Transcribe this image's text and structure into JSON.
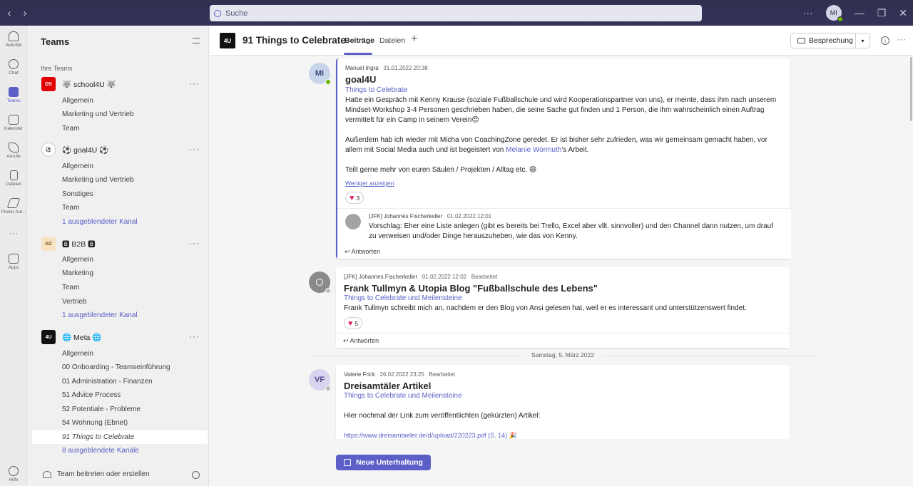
{
  "search": {
    "placeholder": "Suche"
  },
  "topbar": {
    "avatar_initials": "MI",
    "more": "···",
    "min": "—",
    "restore": "❐",
    "close": "✕",
    "back": "‹",
    "forward": "›"
  },
  "rail": [
    {
      "label": "Aktivität",
      "icon": "bell-icon"
    },
    {
      "label": "Chat",
      "icon": "chat-icon"
    },
    {
      "label": "Teams",
      "icon": "teams-icon",
      "active": true
    },
    {
      "label": "Kalender",
      "icon": "calendar-icon"
    },
    {
      "label": "Anrufe",
      "icon": "phone-icon"
    },
    {
      "label": "Dateien",
      "icon": "file-icon"
    },
    {
      "label": "Power Aut...",
      "icon": "power-automate-icon"
    },
    {
      "label": "···",
      "icon": "more-icon"
    },
    {
      "label": "Apps",
      "icon": "apps-icon"
    },
    {
      "label": "Hilfe",
      "icon": "help-icon"
    }
  ],
  "sidebar": {
    "title": "Teams",
    "section": "Ihre Teams",
    "teams": [
      {
        "name": "🐺 school4U 🐺",
        "logo_text": "DS",
        "logo_bg": "#e00000",
        "logo_fg": "#ffffff",
        "channels": [
          "Allgemein",
          "Marketing und Vertrieb",
          "Team"
        ]
      },
      {
        "name": "⚽ goal4U ⚽",
        "logo_text": "⚽",
        "logo_bg": "#ffffff",
        "logo_fg": "#2a7a2a",
        "channels": [
          "Allgemein",
          "Marketing und Vertrieb",
          "Sonstiges",
          "Team"
        ],
        "hidden": "1 ausgeblendeter Kanal"
      },
      {
        "name": "🅱 B2B 🅱",
        "logo_text": "B2",
        "logo_bg": "#f6e3c3",
        "logo_fg": "#8a5a1a",
        "channels": [
          "Allgemein",
          "Marketing",
          "Team",
          "Vertrieb"
        ],
        "hidden": "1 ausgeblendeter Kanal"
      },
      {
        "name": "🌐 Meta 🌐",
        "logo_text": "4U",
        "logo_bg": "#111111",
        "logo_fg": "#ffffff",
        "channels": [
          "Allgemein",
          "00 Onboarding - Teamseinführung",
          "01 Administration - Finanzen",
          "51 Advice Process",
          "52 Potentiale - Probleme",
          "54 Wohnung (Ebnet)",
          "91 Things to Celebrate"
        ],
        "hidden": "8 ausgeblendete Kanäle"
      }
    ],
    "footer": "Team beitreten oder erstellen"
  },
  "header": {
    "logo_text": "4U",
    "title": "91 Things to Celebrate",
    "tabs": [
      "Beiträge",
      "Dateien"
    ],
    "meeting_button": "Besprechung"
  },
  "posts": [
    {
      "author": "Manuel Ingra",
      "time": "31.01.2022 20:38",
      "initials": "MI",
      "subject": "goal4U",
      "tag": "Things to Celebrate",
      "para1": "Hatte ein Gespräch mit Kenny Krause (soziale Fußballschule und wird Kooperationspartner von uns), er meinte, dass ihm nach unserem Mindset-Workshop 3-4 Personen geschrieben haben, die seine Sache gut finden und 1 Person, die ihm wahrscheinlich einen Auftrag vermittelt für ein Camp in seinem Verein😍",
      "para2_a": "Außerdem hab ich wieder mit Micha von CoachingZone geredet. Er ist bisher sehr zufrieden, was wir gemeinsam gemacht haben, vor allem mit Social Media auch und ist begeistert von ",
      "para2_mention": "Melanie Wormuth",
      "para2_b": "'s Arbeit.",
      "para3": "Teilt gerne mehr von euren Säulen / Projekten / Alltag etc. 😄",
      "less": "Weniger anzeigen",
      "reactions": "3",
      "reply": {
        "author": "[JFK] Johannes Fischerkeller",
        "time": "01.02.2022 12:01",
        "text": "Vorschlag: Eher eine Liste anlegen (gibt es bereits bei Trello, Excel aber vllt. sinnvoller) und den Channel dann nutzen, um drauf zu verweisen und/oder Dinge herauszuheben, wie das von Kenny."
      },
      "reply_label": "Antworten"
    },
    {
      "author": "[JFK] Johannes Fischerkeller",
      "time": "01.02.2022 12:02",
      "edited": "Bearbeitet",
      "subject": "Frank Tullmyn & Utopia Blog \"Fußballschule des Lebens\"",
      "tag": "Things to Celebrate und Meilensteine",
      "text": "Frank Tullmyn schreibt mich an, nachdem er den Blog von Ansi gelesen hat, weil er es interessant und unterstützenswert findet.",
      "reactions": "5",
      "reply_label": "Antworten"
    },
    {
      "author": "Valerie Frick",
      "time": "26.02.2022 23:25",
      "edited": "Bearbeitet",
      "initials": "VF",
      "subject": "Dreisamtäler Artikel",
      "tag": "Things to Celebrate und Meilensteine",
      "text": "Hier nochmal der Link zum veröffentlichten (gekürzten) Artikel:",
      "link": "https://www.dreisamtaeler.de/d/upload/220223.pdf (S. 14) 🎉"
    }
  ],
  "date_separator": "Samstag, 5. März 2022",
  "new_conversation": "Neue Unterhaltung",
  "colors": {
    "accent": "#5b5fc7",
    "topbar": "#2f2f4e",
    "heart": "#e0245e",
    "online": "#6bb700"
  }
}
